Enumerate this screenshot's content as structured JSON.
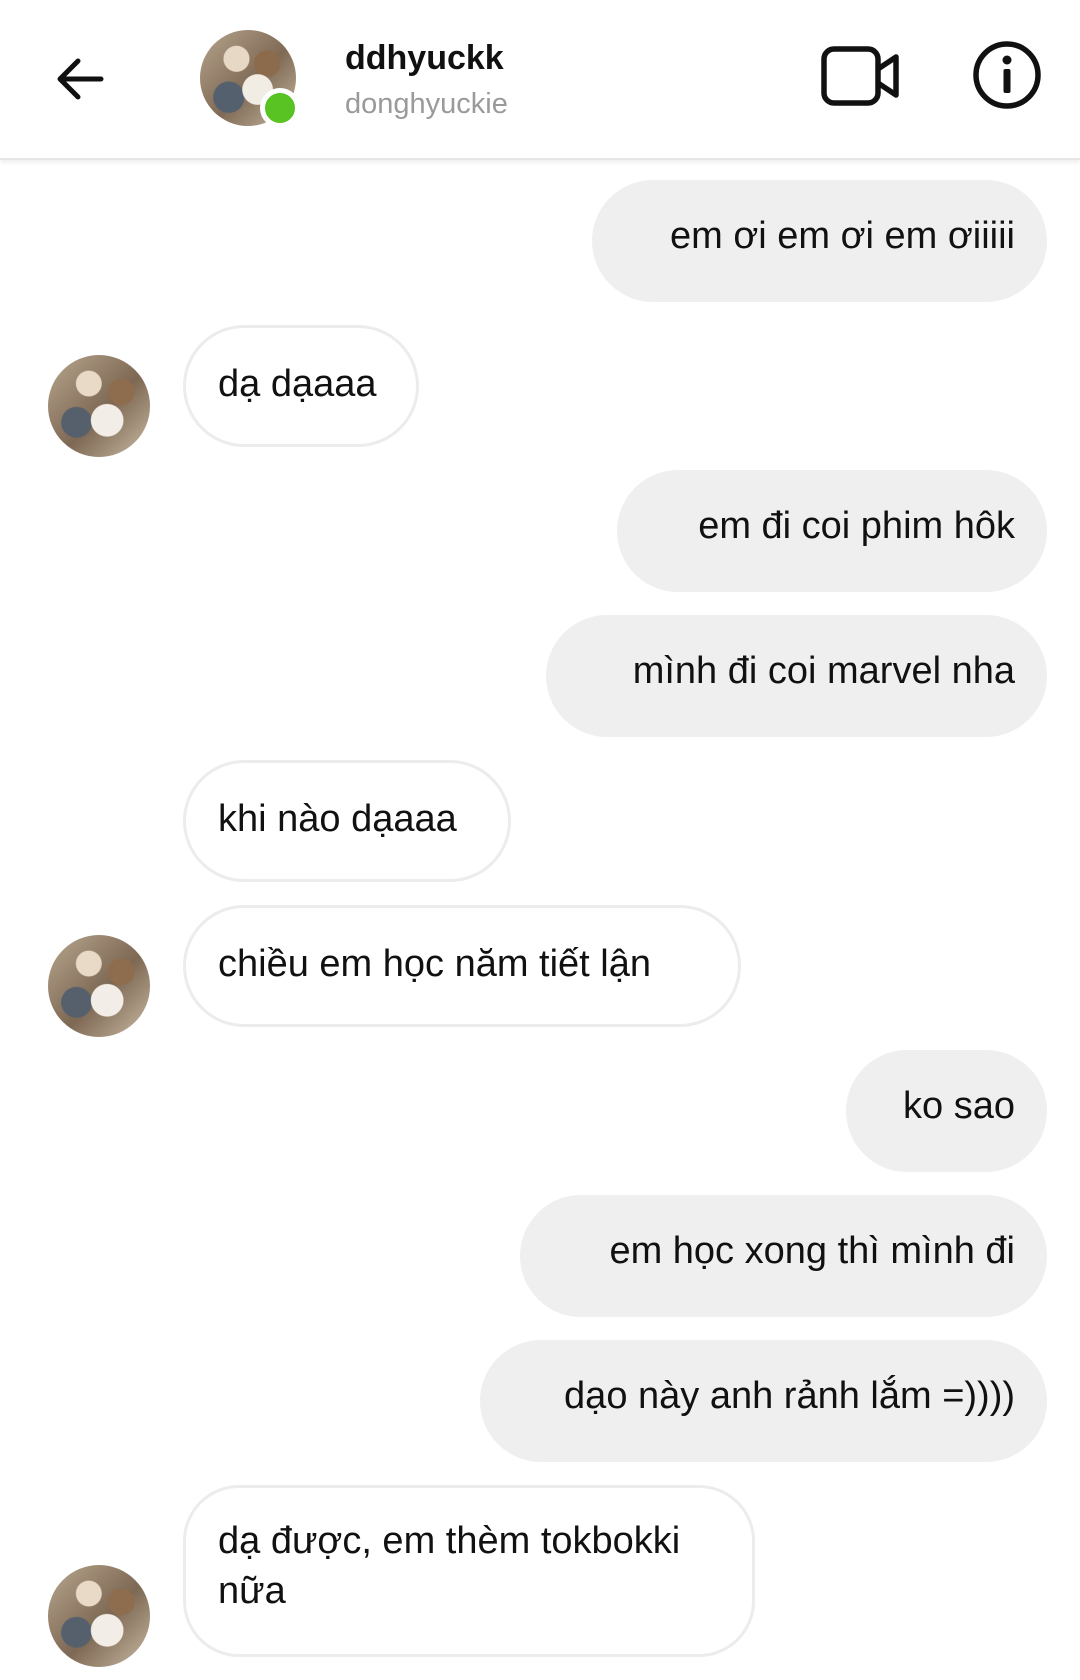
{
  "header": {
    "display_name": "ddhyuckk",
    "username": "donghyuckie",
    "back_icon": "arrow-left-icon",
    "video_icon": "video-camera-icon",
    "info_icon": "info-icon",
    "online_status_color": "#58c322"
  },
  "messages": [
    {
      "from": "me",
      "text": "em ơi em ơi em ơiiiii"
    },
    {
      "from": "them",
      "text": "dạ dạaaa"
    },
    {
      "from": "me",
      "text": "em đi coi phim hôk"
    },
    {
      "from": "me",
      "text": "mình đi coi marvel nha"
    },
    {
      "from": "them",
      "text": "khi nào dạaaa"
    },
    {
      "from": "them",
      "text": "chiều em học năm tiết lận"
    },
    {
      "from": "me",
      "text": "ko sao"
    },
    {
      "from": "me",
      "text": "em học xong thì mình đi"
    },
    {
      "from": "me",
      "text": "dạo này anh rảnh lắm =))))"
    },
    {
      "from": "them",
      "text": "dạ được, em thèm tokbokki nữa"
    }
  ],
  "colors": {
    "outgoing_bubble": "#efefef",
    "incoming_border": "#ececec"
  }
}
